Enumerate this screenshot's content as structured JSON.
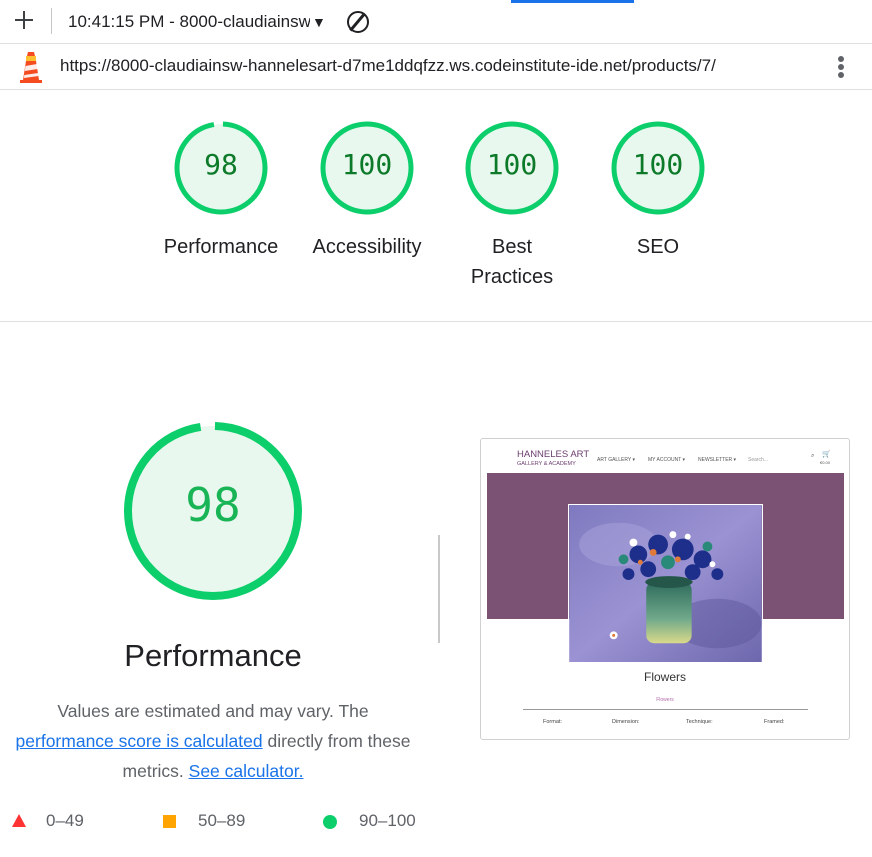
{
  "toolbar": {
    "session_label": "10:41:15 PM - 8000-claudiainsw",
    "caret": "▼"
  },
  "urlbar": {
    "url": "https://8000-claudiainsw-hannelesart-d7me1ddqfzz.ws.codeinstitute-ide.net/products/7/"
  },
  "categories": [
    {
      "score": "98",
      "fraction": 0.98,
      "label": "Performance"
    },
    {
      "score": "100",
      "fraction": 1.0,
      "label": "Accessibility"
    },
    {
      "score": "100",
      "fraction": 1.0,
      "label_line1": "Best",
      "label_line2": "Practices"
    },
    {
      "score": "100",
      "fraction": 1.0,
      "label": "SEO"
    }
  ],
  "performance": {
    "score": "98",
    "fraction": 0.98,
    "title": "Performance",
    "desc_text1": "Values are estimated and may vary. The",
    "desc_link1": "performance score is calculated",
    "desc_text2": "directly from these",
    "desc_text3": "metrics.",
    "desc_link2": "See calculator."
  },
  "legend": {
    "fail": "0–49",
    "average": "50–89",
    "pass": "90–100"
  },
  "thumbnail": {
    "brand_line1": "HANNELES ART",
    "brand_line2": "GALLERY & ACADEMY",
    "nav": [
      "ART GALLERY ▾",
      "MY ACCOUNT ▾",
      "NEWSLETTER ▾",
      "Search..."
    ],
    "bag_label": "€0.00",
    "title": "Flowers",
    "subtitle": "Flowers",
    "specs": [
      "Format:",
      "Dimension:",
      "Technique:",
      "Framed:"
    ]
  },
  "colors": {
    "pass_green": "#0cce6b",
    "pass_fill": "#e8f8ee",
    "pass_text": "#0c7a28",
    "average_orange": "#ffa400",
    "fail_red": "#ff3333",
    "link_blue": "#1a73e8",
    "banner_purple": "#7b5273"
  }
}
